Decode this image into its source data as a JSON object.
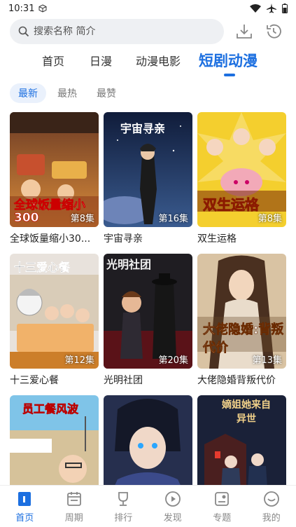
{
  "status": {
    "time": "10:31"
  },
  "search": {
    "placeholder": "搜索名称 简介"
  },
  "top_tabs": [
    {
      "label": "首页",
      "active": false
    },
    {
      "label": "日漫",
      "active": false
    },
    {
      "label": "动漫电影",
      "active": false
    },
    {
      "label": "短剧动漫",
      "active": true
    }
  ],
  "sub_tabs": [
    {
      "label": "最新",
      "active": true
    },
    {
      "label": "最热",
      "active": false
    },
    {
      "label": "最赞",
      "active": false
    }
  ],
  "cards": [
    {
      "title": "全球饭量缩小30...",
      "episodes": "第8集",
      "poster_text": "全球饭量缩小300"
    },
    {
      "title": "宇宙寻亲",
      "episodes": "第16集",
      "poster_text": "宇宙寻亲"
    },
    {
      "title": "双生运格",
      "episodes": "第8集",
      "poster_text": "双生运格"
    },
    {
      "title": "十三爱心餐",
      "episodes": "第12集",
      "poster_text": "十三爱心餐"
    },
    {
      "title": "光明社团",
      "episodes": "第20集",
      "poster_text": "光明社团"
    },
    {
      "title": "大佬隐婚背叛代价",
      "episodes": "第13集",
      "poster_text": "大佬隐婚:背叛代价"
    },
    {
      "title": "",
      "episodes": "",
      "poster_text": "员工餐风波"
    },
    {
      "title": "",
      "episodes": "",
      "poster_text": ""
    },
    {
      "title": "",
      "episodes": "",
      "poster_text": "嫡姐她来自异世"
    }
  ],
  "bottom_nav": [
    {
      "label": "首页",
      "icon": "home-icon",
      "active": true
    },
    {
      "label": "周期",
      "icon": "calendar-icon",
      "active": false
    },
    {
      "label": "排行",
      "icon": "trophy-icon",
      "active": false
    },
    {
      "label": "发现",
      "icon": "play-circle-icon",
      "active": false
    },
    {
      "label": "专题",
      "icon": "topic-icon",
      "active": false
    },
    {
      "label": "我的",
      "icon": "profile-icon",
      "active": false
    }
  ],
  "colors": {
    "accent": "#1c6fe0",
    "inactive": "#888888",
    "search_bg": "#eef0f3"
  }
}
